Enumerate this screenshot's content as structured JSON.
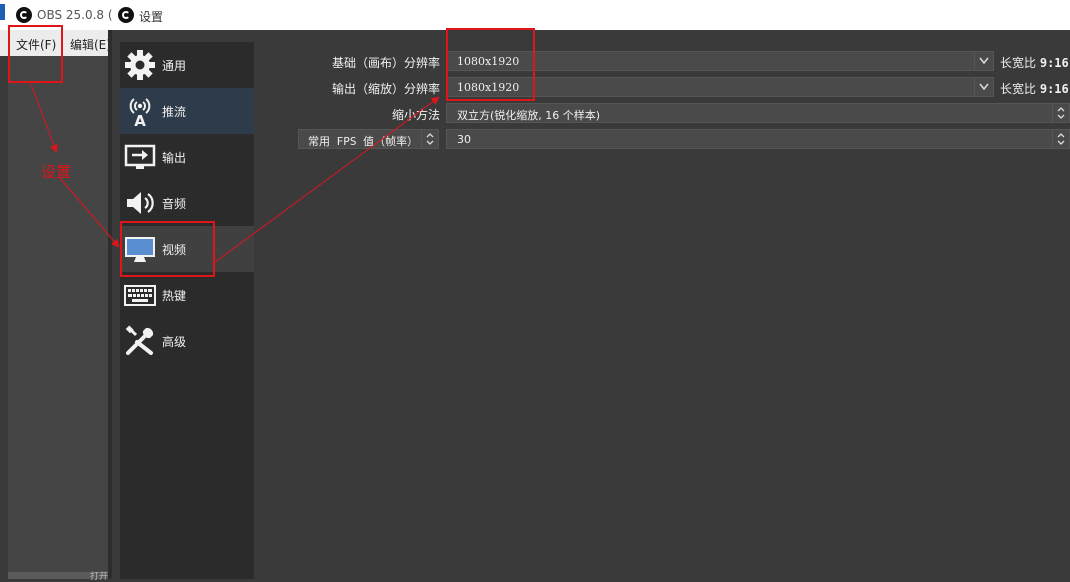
{
  "main_window": {
    "title": "OBS 25.0.8 (",
    "menu": {
      "file": "文件(F)",
      "edit": "编辑(E)"
    },
    "bottom_fragment": "打开"
  },
  "settings": {
    "title": "设置",
    "sidebar": [
      {
        "label": "通用",
        "icon": "gear-icon"
      },
      {
        "label": "推流",
        "icon": "antenna-icon"
      },
      {
        "label": "输出",
        "icon": "output-icon"
      },
      {
        "label": "音频",
        "icon": "speaker-icon"
      },
      {
        "label": "视频",
        "icon": "monitor-icon"
      },
      {
        "label": "热键",
        "icon": "keyboard-icon"
      },
      {
        "label": "高级",
        "icon": "tools-icon"
      }
    ],
    "video": {
      "base_label": "基础（画布）分辨率",
      "base_value": "1080x1920",
      "base_ratio_label": "长宽比",
      "base_ratio": "9:16",
      "output_label": "输出（缩放）分辨率",
      "output_value": "1080x1920",
      "output_ratio_label": "长宽比",
      "output_ratio": "9:16",
      "downscale_label": "缩小方法",
      "downscale_value": "双立方(锐化缩放, 16 个样本)",
      "fps_type": "常用 FPS 值（帧率）",
      "fps_value": "30"
    }
  },
  "annotation": {
    "text": "设置",
    "color": "#e0141b"
  }
}
